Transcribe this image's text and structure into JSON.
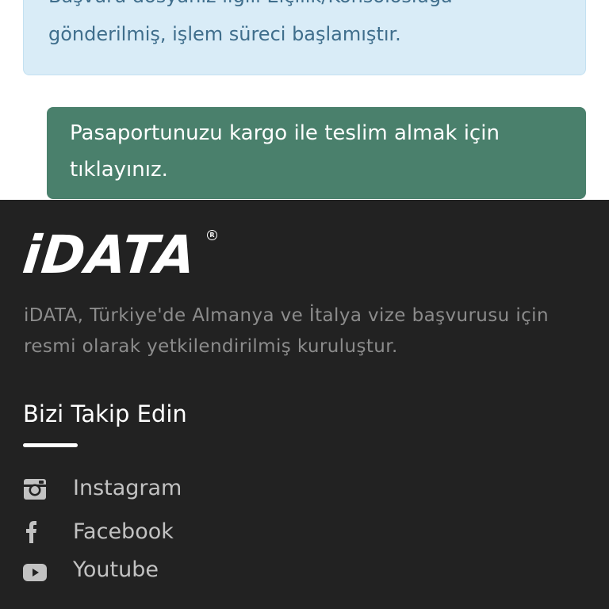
{
  "notice": {
    "line1": "Başvuru dosyanız ilgili Elçilik/Konsolosluğa",
    "line2": "gönderilmiş, işlem süreci başlamıştır."
  },
  "cargo_button": {
    "label": "Pasaportunuzu kargo ile teslim almak için tıklayınız."
  },
  "footer": {
    "logo_text": "iDATA",
    "description": "iDATA, Türkiye'de Almanya ve İtalya vize başvurusu için resmi olarak yetkilendirilmiş kuruluştur.",
    "follow_title": "Bizi Takip Edin",
    "social": [
      {
        "label": "Instagram",
        "icon": "instagram-icon"
      },
      {
        "label": "Facebook",
        "icon": "facebook-icon"
      },
      {
        "label": "Youtube",
        "icon": "youtube-icon"
      }
    ]
  },
  "colors": {
    "notice_bg": "#d9ecf7",
    "notice_text": "#3f6e8c",
    "button_bg": "#4a806c",
    "footer_bg": "#222222"
  }
}
